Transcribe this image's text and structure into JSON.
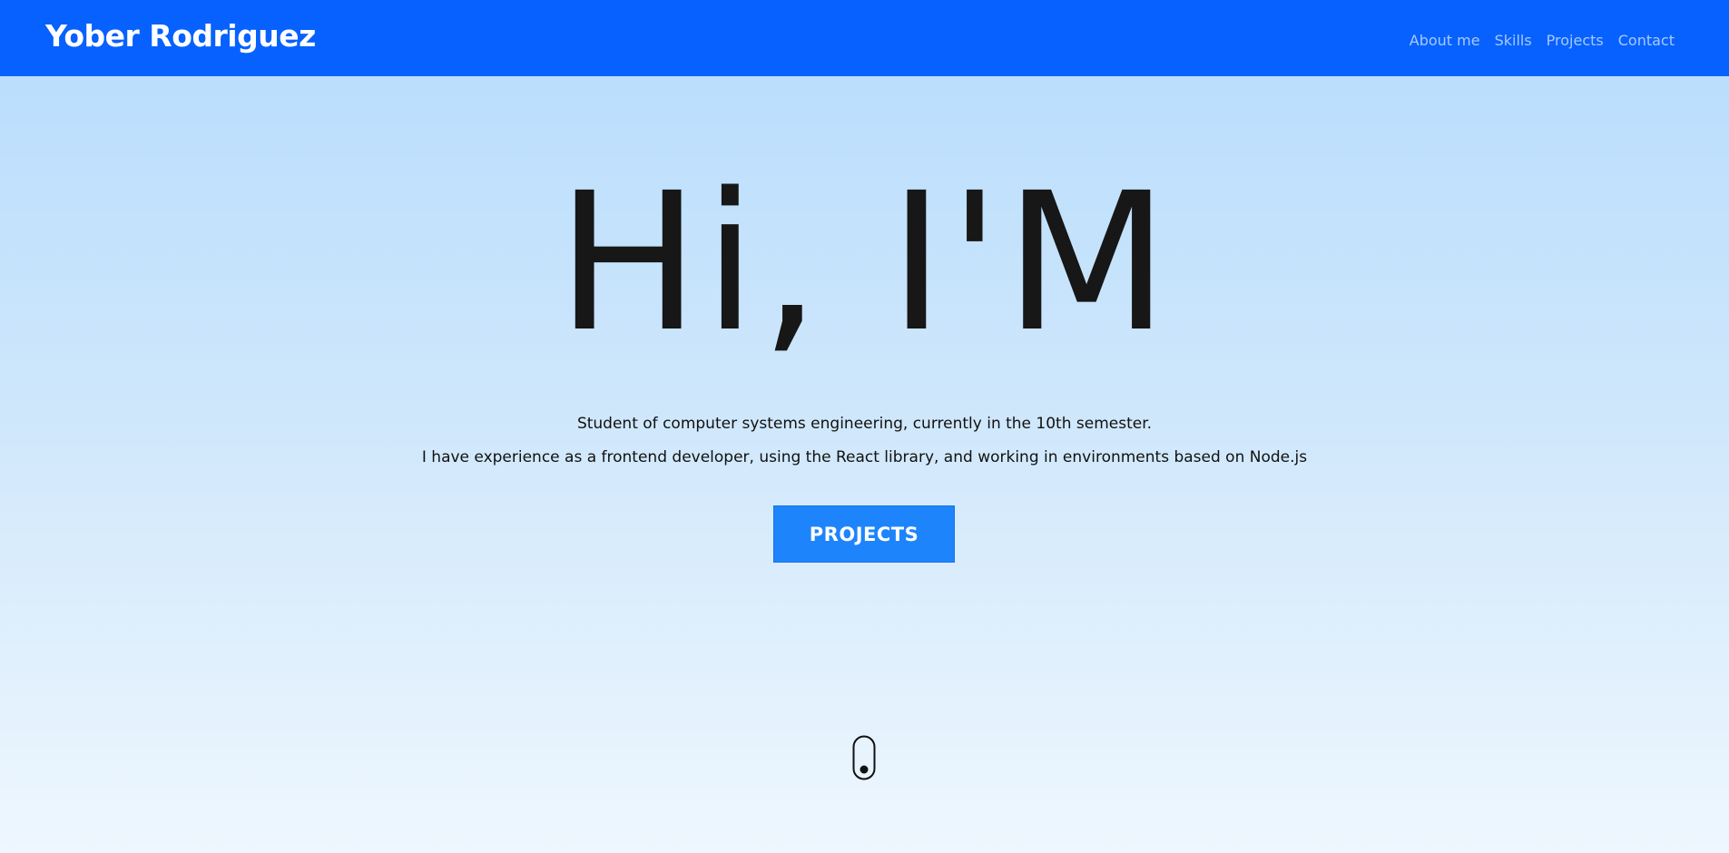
{
  "navbar": {
    "brand": "Yober Rodriguez",
    "links": [
      "About me",
      "Skills",
      "Projects",
      "Contact"
    ],
    "bg_color": "#0761fe"
  },
  "hero": {
    "title": "Hi, I'M",
    "line1": "Student of computer systems engineering, currently in the 10th semester.",
    "line2": "I have experience as a frontend developer, using the React library, and working in environments based on Node.js",
    "button_label": "PROJECTS",
    "button_color": "#1e84fc"
  },
  "icons": {
    "scroll": "mouse-scroll-icon"
  }
}
